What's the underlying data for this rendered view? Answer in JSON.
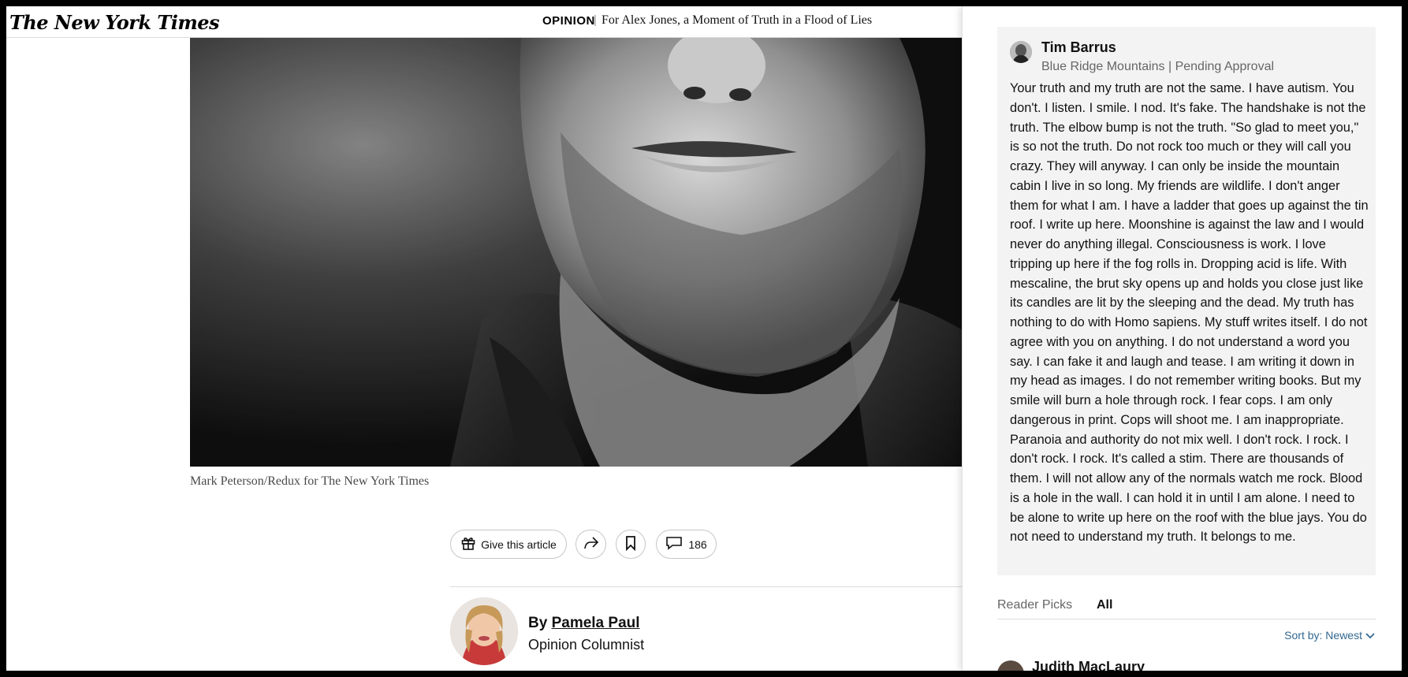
{
  "header": {
    "logo": "The New York Times",
    "section": "OPINION",
    "headline": "For Alex Jones, a Moment of Truth in a Flood of Lies"
  },
  "article": {
    "photo_caption": "Mark Peterson/Redux for The New York Times",
    "toolbar": {
      "gift_label": "Give this article",
      "comment_count": "186"
    },
    "byline": {
      "prefix": "By",
      "author": "Pamela Paul",
      "role": "Opinion Columnist"
    }
  },
  "comments_panel": {
    "featured_comment": {
      "name": "Tim Barrus",
      "meta": "Blue Ridge Mountains | Pending Approval",
      "body": "Your truth and my truth are not the same. I have autism. You don't. I listen. I smile. I nod. It's fake. The handshake is not the truth. The elbow bump is not the truth. \"So glad to meet you,\" is so not the truth. Do not rock too much or they will call you crazy. They will anyway. I can only be inside the mountain cabin I live in so long. My friends are wildlife. I don't anger them for what I am. I have a ladder that goes up against the tin roof. I write up here. Moonshine is against the law and I would never do anything illegal. Consciousness is work. I love tripping up here if the fog rolls in. Dropping acid is life. With mescaline, the brut sky opens up and holds you close just like its candles are lit by the sleeping and the dead. My truth has nothing to do with Homo sapiens. My stuff writes itself. I do not agree with you on anything. I do not understand a word you say. I can fake it and laugh and tease. I am writing it down in my head as images. I do not remember writing books. But my smile will burn a hole through rock. I fear cops. I am only dangerous in print. Cops will shoot me. I am inappropriate. Paranoia and authority do not mix well. I don't rock. I rock. I don't rock. I rock. It's called a stim. There are thousands of them. I will not allow any of the normals watch me rock. Blood is a hole in the wall. I can hold it in until I am alone. I need to be alone to write up here on the roof with the blue jays. You do not need to understand my truth. It belongs to me."
    },
    "tabs": {
      "reader_picks": "Reader Picks",
      "all": "All"
    },
    "sort_label": "Sort by: Newest",
    "next_commenter": "Judith MacLaury"
  },
  "icons": [
    "gift-icon",
    "share-icon",
    "bookmark-icon",
    "comment-icon",
    "chevron-down-icon"
  ],
  "colors": {
    "link_blue": "#326891",
    "card_bg": "#f3f3f3",
    "muted_text": "#666666"
  }
}
